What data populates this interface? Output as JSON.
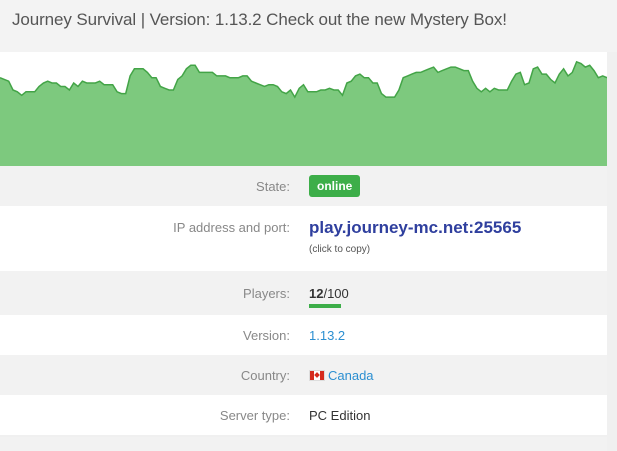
{
  "header": {
    "title": "Journey Survival | Version: 1.13.2 Check out the new Mystery Box!"
  },
  "chart_data": {
    "type": "area",
    "values": [
      50,
      49,
      48,
      43,
      42,
      40,
      42,
      42,
      42,
      45,
      47,
      48,
      47,
      47,
      45,
      45,
      43,
      47,
      45,
      48,
      47,
      47,
      47,
      48,
      46,
      46,
      46,
      42,
      41,
      41,
      51,
      55,
      55,
      55,
      53,
      50,
      50,
      45,
      44,
      43,
      43,
      49,
      51,
      55,
      57,
      57,
      53,
      53,
      53,
      53,
      51,
      51,
      51,
      50,
      50,
      50,
      51,
      51,
      48,
      47,
      46,
      45,
      46,
      46,
      45,
      42,
      41,
      43,
      39,
      44,
      46,
      42,
      42,
      42,
      43,
      43,
      44,
      43,
      43,
      40,
      47,
      48,
      51,
      52,
      50,
      50,
      47,
      47,
      41,
      39,
      39,
      39,
      43,
      50,
      51,
      52,
      53,
      53,
      54,
      55,
      56,
      53,
      54,
      55,
      56,
      56,
      55,
      54,
      54,
      48,
      44,
      42,
      44,
      42,
      44,
      43,
      43,
      43,
      48,
      52,
      53,
      46,
      47,
      55,
      56,
      52,
      52,
      49,
      47,
      52,
      55,
      51,
      53,
      59,
      58,
      56,
      57,
      54,
      50,
      51,
      50
    ],
    "ylim": [
      0,
      60
    ],
    "color": "#7dc97e",
    "line_color": "#43a447"
  },
  "rows": {
    "state": {
      "label": "State:",
      "value": "online"
    },
    "ip": {
      "label": "IP address and port:",
      "value": "play.journey-mc.net:25565",
      "hint": "(click to copy)"
    },
    "players": {
      "label": "Players:",
      "online": "12",
      "max": "/100",
      "fill": 0.12
    },
    "version": {
      "label": "Version:",
      "value": "1.13.2"
    },
    "country": {
      "label": "Country:",
      "value": "Canada"
    },
    "type": {
      "label": "Server type:",
      "value": "PC Edition"
    }
  },
  "colors": {
    "online_badge": "#3dae49",
    "ip_link": "#2f3f9e",
    "link": "#2b8fd1"
  }
}
